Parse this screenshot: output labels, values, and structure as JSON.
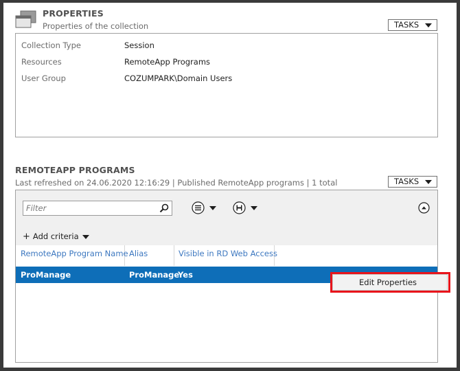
{
  "properties": {
    "title": "PROPERTIES",
    "subtitle": "Properties of the collection",
    "tasks_label": "TASKS",
    "rows": [
      {
        "label": "Collection Type",
        "value": "Session"
      },
      {
        "label": "Resources",
        "value": "RemoteApp Programs"
      },
      {
        "label": "User Group",
        "value": "COZUMPARK\\Domain Users"
      }
    ]
  },
  "remoteapp": {
    "title": "REMOTEAPP PROGRAMS",
    "subtitle": "Last refreshed on 24.06.2020 12:16:29 | Published RemoteApp programs  | 1 total",
    "tasks_label": "TASKS",
    "filter_placeholder": "Filter",
    "add_criteria_label": "Add criteria",
    "columns": [
      "RemoteApp Program Name",
      "Alias",
      "Visible in RD Web Access"
    ],
    "rows": [
      {
        "name": "ProManage",
        "alias": "ProManage",
        "visible": "Yes",
        "selected": true
      }
    ]
  },
  "context_menu": {
    "items": [
      "Edit Properties"
    ]
  },
  "colors": {
    "selection": "#0e6eb8",
    "column_header": "#3d78c0",
    "highlight": "#e8141b"
  }
}
